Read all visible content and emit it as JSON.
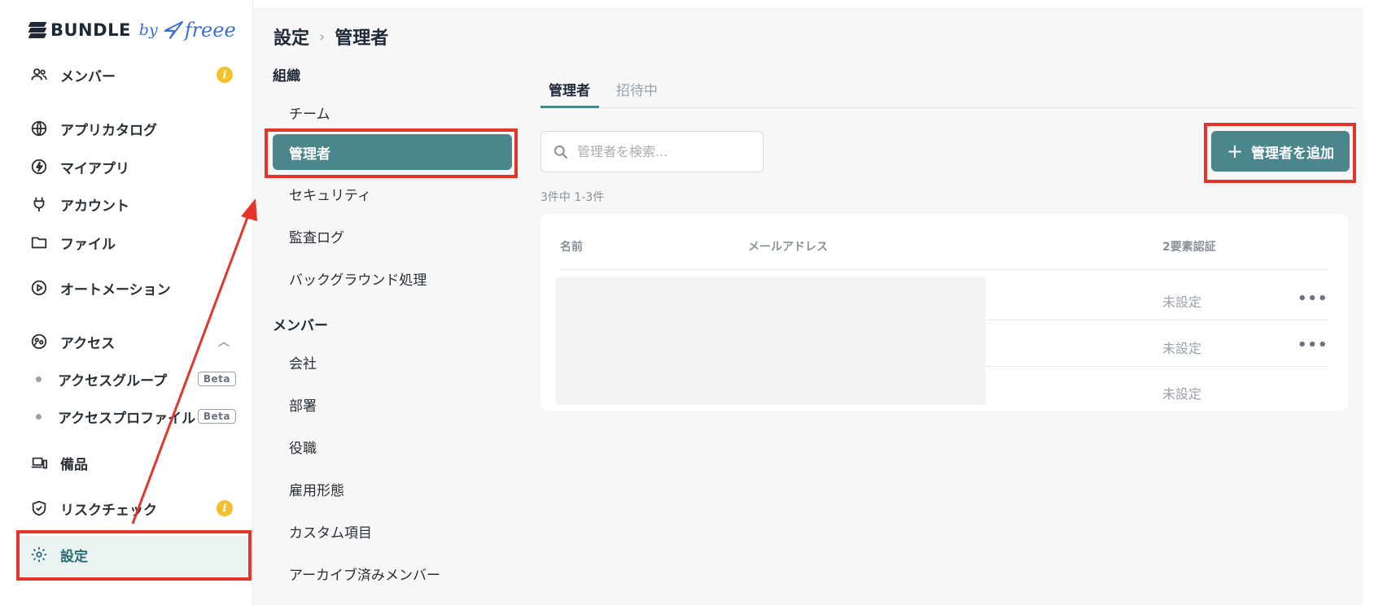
{
  "brand": {
    "name": "BUNDLE",
    "by": "by",
    "partner": "freee"
  },
  "sidebar": {
    "items": [
      {
        "label": "メンバー",
        "icon": "users-icon",
        "badge": "i"
      },
      {
        "label": "アプリカタログ",
        "icon": "globe-icon"
      },
      {
        "label": "マイアプリ",
        "icon": "bolt-icon"
      },
      {
        "label": "アカウント",
        "icon": "plug-icon"
      },
      {
        "label": "ファイル",
        "icon": "folder-icon"
      },
      {
        "label": "オートメーション",
        "icon": "play-circle-icon"
      },
      {
        "label": "アクセス",
        "icon": "access-icon"
      },
      {
        "label": "備品",
        "icon": "devices-icon"
      },
      {
        "label": "リスクチェック",
        "icon": "shield-icon",
        "badge": "i"
      },
      {
        "label": "設定",
        "icon": "gear-icon",
        "active": true
      }
    ],
    "access_sub": [
      {
        "label": "アクセスグループ",
        "badge": "Beta"
      },
      {
        "label": "アクセスプロファイル",
        "badge": "Beta"
      }
    ]
  },
  "breadcrumb": {
    "parent": "設定",
    "sep": "›",
    "current": "管理者"
  },
  "settings_nav": {
    "org_title": "組織",
    "org_items": [
      "チーム",
      "管理者",
      "セキュリティ",
      "監査ログ",
      "バックグラウンド処理"
    ],
    "member_title": "メンバー",
    "member_items": [
      "会社",
      "部署",
      "役職",
      "雇用形態",
      "カスタム項目",
      "アーカイブ済みメンバー"
    ]
  },
  "tabs": {
    "active": "管理者",
    "inactive": "招待中"
  },
  "search": {
    "placeholder": "管理者を検索..."
  },
  "add_button": {
    "plus": "+",
    "label": "管理者を追加"
  },
  "count_text": "3件中 1-3件",
  "table": {
    "columns": [
      "名前",
      "メールアドレス",
      "2要素認証"
    ],
    "rows": [
      {
        "two_factor": "未設定",
        "menu": "•••"
      },
      {
        "two_factor": "未設定",
        "menu": "•••"
      },
      {
        "two_factor": "未設定",
        "menu": ""
      }
    ]
  },
  "colors": {
    "accent": "#4a868c",
    "highlight": "#e5352b",
    "info": "#f5c02d",
    "brand_blue": "#3b6fd8"
  }
}
